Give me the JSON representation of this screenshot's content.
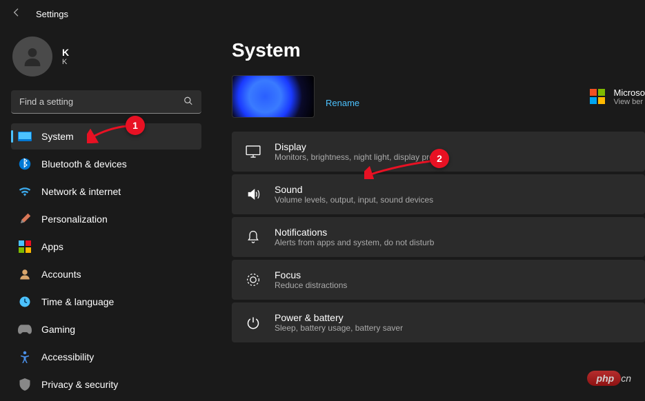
{
  "header": {
    "title": "Settings"
  },
  "profile": {
    "name": "K",
    "sub": "K"
  },
  "search": {
    "placeholder": "Find a setting"
  },
  "sidebar": {
    "items": [
      {
        "label": "System",
        "icon": "system",
        "selected": true
      },
      {
        "label": "Bluetooth & devices",
        "icon": "bluetooth"
      },
      {
        "label": "Network & internet",
        "icon": "network"
      },
      {
        "label": "Personalization",
        "icon": "personalization"
      },
      {
        "label": "Apps",
        "icon": "apps"
      },
      {
        "label": "Accounts",
        "icon": "accounts"
      },
      {
        "label": "Time & language",
        "icon": "time"
      },
      {
        "label": "Gaming",
        "icon": "gaming"
      },
      {
        "label": "Accessibility",
        "icon": "accessibility"
      },
      {
        "label": "Privacy & security",
        "icon": "privacy"
      }
    ]
  },
  "page": {
    "title": "System",
    "rename": "Rename",
    "ms365": {
      "title": "Microso",
      "sub": "View ber"
    },
    "cards": [
      {
        "title": "Display",
        "sub": "Monitors, brightness, night light, display profile",
        "icon": "display"
      },
      {
        "title": "Sound",
        "sub": "Volume levels, output, input, sound devices",
        "icon": "sound"
      },
      {
        "title": "Notifications",
        "sub": "Alerts from apps and system, do not disturb",
        "icon": "notifications"
      },
      {
        "title": "Focus",
        "sub": "Reduce distractions",
        "icon": "focus"
      },
      {
        "title": "Power & battery",
        "sub": "Sleep, battery usage, battery saver",
        "icon": "power"
      }
    ]
  },
  "callouts": {
    "one": "1",
    "two": "2"
  },
  "watermark": {
    "a": "php",
    "b": "cn"
  }
}
